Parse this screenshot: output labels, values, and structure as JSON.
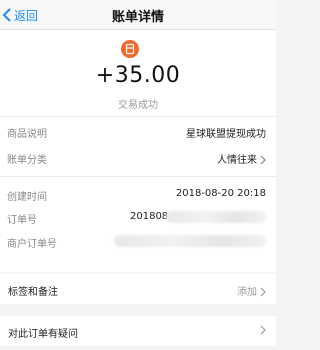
{
  "nav": {
    "back_label": "返回",
    "title": "账单详情"
  },
  "summary": {
    "icon": "red-packet-icon",
    "amount": "+35.00",
    "status": "交易成功"
  },
  "details": [
    {
      "label": "商品说明",
      "value": "星球联盟提现成功"
    },
    {
      "label": "账单分类",
      "value": "人情往来"
    },
    {
      "label": "创建时间",
      "value": "2018-08-20 20:18"
    },
    {
      "label": "订单号",
      "value": "201808"
    },
    {
      "label": "商户订单号",
      "value": ""
    }
  ],
  "tags": {
    "label": "标签和备注",
    "action": "添加"
  },
  "question": {
    "label": "对此订单有疑问"
  },
  "colors": {
    "accent": "#1d8cf8",
    "icon_bg": "#f26a2d"
  }
}
